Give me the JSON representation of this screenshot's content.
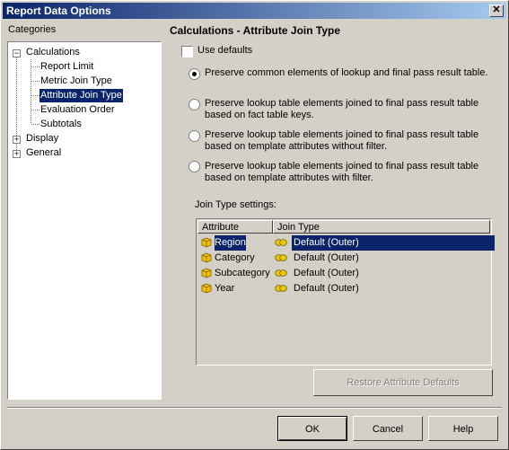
{
  "window": {
    "title": "Report Data Options",
    "close_glyph": "✕"
  },
  "categories_label": "Categories",
  "tree": {
    "calculations": {
      "label": "Calculations",
      "expander": "−"
    },
    "children": [
      "Report Limit",
      "Metric Join Type",
      "Attribute Join Type",
      "Evaluation Order",
      "Subtotals"
    ],
    "display": {
      "label": "Display",
      "expander": "+"
    },
    "general": {
      "label": "General",
      "expander": "+"
    },
    "selected": "Attribute Join Type"
  },
  "section_title": "Calculations - Attribute Join Type",
  "use_defaults": {
    "label": "Use defaults",
    "checked": false
  },
  "options": [
    {
      "line1": "Preserve common elements of lookup and final pass result table.",
      "line2": "",
      "selected": true
    },
    {
      "line1": "Preserve lookup table elements joined to final pass result table",
      "line2": "based on fact table keys.",
      "selected": false
    },
    {
      "line1": "Preserve lookup table elements joined to final pass result table",
      "line2": "based on template attributes without filter.",
      "selected": false
    },
    {
      "line1": "Preserve lookup table elements joined to final pass result table",
      "line2": "based on template attributes with filter.",
      "selected": false
    }
  ],
  "join_settings_label": "Join Type settings:",
  "grid": {
    "headers": {
      "attribute": "Attribute",
      "join_type": "Join Type"
    },
    "rows": [
      {
        "attribute": "Region",
        "join_type": "Default (Outer)",
        "selected": true
      },
      {
        "attribute": "Category",
        "join_type": "Default (Outer)",
        "selected": false
      },
      {
        "attribute": "Subcategory",
        "join_type": "Default (Outer)",
        "selected": false
      },
      {
        "attribute": "Year",
        "join_type": "Default (Outer)",
        "selected": false
      }
    ]
  },
  "restore_button": "Restore Attribute Defaults",
  "buttons": {
    "ok": "OK",
    "cancel": "Cancel",
    "help": "Help"
  },
  "colors": {
    "face": "#d4d0c8",
    "selection": "#0a246a",
    "title_start": "#0a246a",
    "title_end": "#a6caf0",
    "cube": "#f0c000",
    "join_icon": "#e8c800"
  }
}
